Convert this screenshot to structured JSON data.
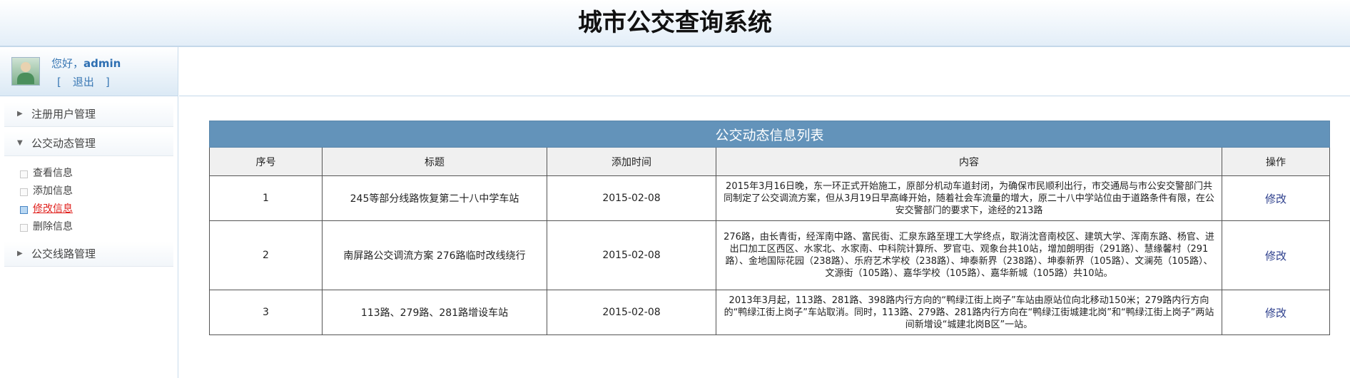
{
  "app": {
    "title": "城市公交查询系统"
  },
  "user": {
    "greeting": "您好，",
    "name": "admin",
    "logout_open": "[",
    "logout_label": "退出",
    "logout_close": "]"
  },
  "sidebar": {
    "sections": [
      {
        "label": "注册用户管理",
        "arrow": "▶"
      },
      {
        "label": "公交动态管理",
        "arrow": "▼",
        "items": [
          {
            "label": "查看信息"
          },
          {
            "label": "添加信息"
          },
          {
            "label": "修改信息",
            "active": true
          },
          {
            "label": "删除信息"
          }
        ]
      },
      {
        "label": "公交线路管理",
        "arrow": "▶"
      }
    ]
  },
  "table": {
    "caption": "公交动态信息列表",
    "headers": [
      "序号",
      "标题",
      "添加时间",
      "内容",
      "操作"
    ],
    "rows": [
      {
        "no": "1",
        "title": "245等部分线路恢复第二十八中学车站",
        "date": "2015-02-08",
        "content": "2015年3月16日晚，东一环正式开始施工，原部分机动车道封闭，为确保市民顺利出行，市交通局与市公安交警部门共同制定了公交调流方案，但从3月19日早高峰开始，随着社会车流量的增大，原二十八中学站位由于道路条件有限，在公安交警部门的要求下，途经的213路",
        "action": "修改"
      },
      {
        "no": "2",
        "title": "南屏路公交调流方案 276路临时改线绕行",
        "date": "2015-02-08",
        "content": "276路，由长青街，经浑南中路、富民街、汇泉东路至理工大学终点，取消沈音南校区、建筑大学、浑南东路、杨官、进出口加工区西区、水家北、水家南、中科院计算所、罗官屯、观象台共10站，增加朗明街（291路）、慧缘馨村（291路）、金地国际花园（238路）、乐府艺术学校（238路）、坤泰新界（238路）、坤泰新界（105路）、文澜苑（105路）、文源街（105路）、嘉华学校（105路）、嘉华新城（105路）共10站。",
        "action": "修改"
      },
      {
        "no": "3",
        "title": "113路、279路、281路增设车站",
        "date": "2015-02-08",
        "content": "2013年3月起，113路、281路、398路内行方向的“鸭绿江街上岗子”车站由原站位向北移动150米；279路内行方向的“鸭绿江街上岗子”车站取消。同时，113路、279路、281路内行方向在“鸭绿江街城建北岗”和“鸭绿江街上岗子”两站间新增设“城建北岗B区”一站。",
        "action": "修改"
      }
    ]
  },
  "colors": {
    "caption_bg": "#6393ba",
    "link": "#3a78b4",
    "active": "#e0201c"
  }
}
